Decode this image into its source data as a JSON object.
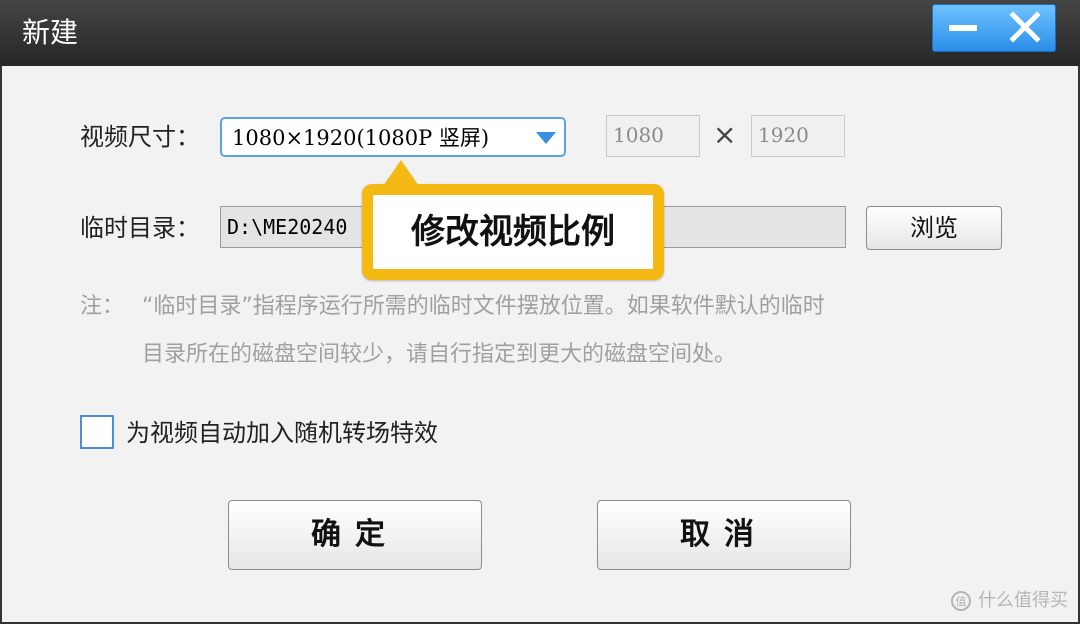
{
  "window": {
    "title": "新建"
  },
  "form": {
    "size_label": "视频尺寸：",
    "size_select_value": "1080×1920(1080P 竖屏)",
    "width_value": "1080",
    "times_symbol": "×",
    "height_value": "1920",
    "dir_label": "临时目录：",
    "dir_value": "D:\\ME20240",
    "browse_label": "浏览",
    "note_prefix": "注：",
    "note_line1": "“临时目录”指程序运行所需的临时文件摆放位置。如果软件默认的临时",
    "note_line2": "目录所在的磁盘空间较少，请自行指定到更大的磁盘空间处。",
    "checkbox_label": "为视频自动加入随机转场特效",
    "checkbox_checked": false
  },
  "buttons": {
    "ok_label": "确定",
    "cancel_label": "取消"
  },
  "callout": {
    "text": "修改视频比例",
    "border_color": "#f5b914"
  },
  "watermark": {
    "text": "什么值得买"
  },
  "icons": {
    "minimize": "minimize-icon",
    "close": "close-icon",
    "dropdown": "chevron-down-icon",
    "watermark": "watermark-logo-icon"
  },
  "colors": {
    "titlebar": "#2e2e2e",
    "accent_blue": "#2a8ee8",
    "callout": "#f5b914"
  }
}
